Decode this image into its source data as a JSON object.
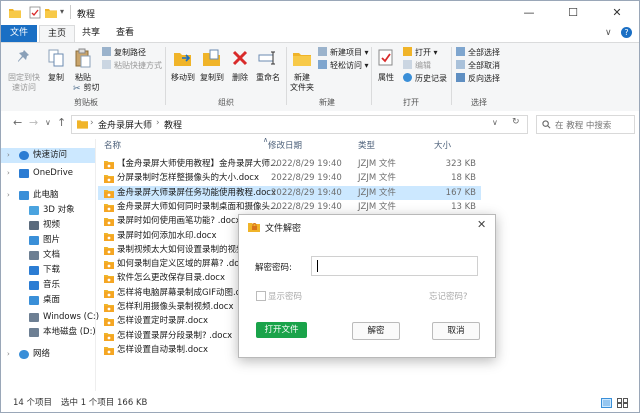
{
  "window": {
    "title": "教程",
    "controls": {
      "minimize": "—",
      "maximize": "☐",
      "close": "✕"
    },
    "quick_access": {
      "dropdown": "▾"
    }
  },
  "ribbon_tabs": [
    "文件",
    "主页",
    "共享",
    "查看"
  ],
  "ribbon": {
    "collapse_arrow": "∨",
    "help": "?",
    "clipboard": {
      "pin_line1": "固定到快",
      "pin_line2": "速访问",
      "copy": "复制",
      "paste": "粘贴",
      "copy_path": "复制路径",
      "paste_shortcut": "粘贴快捷方式",
      "cut": "剪切",
      "label": "剪贴板"
    },
    "organize": {
      "move_to": "移动到",
      "copy_to": "复制到",
      "delete": "删除",
      "rename": "重命名",
      "label": "组织"
    },
    "new": {
      "new_folder_line1": "新建",
      "new_folder_line2": "文件夹",
      "new_item": "新建项目 ▾",
      "easy_access": "轻松访问 ▾",
      "label": "新建"
    },
    "open": {
      "properties": "属性",
      "open": "打开 ▾",
      "edit": "编辑",
      "history": "历史记录",
      "label": "打开"
    },
    "select": {
      "select_all": "全部选择",
      "select_none": "全部取消",
      "invert": "反向选择",
      "label": "选择"
    }
  },
  "address_bar": {
    "back": "←",
    "forward": "→",
    "recent": "∨",
    "up": "↑",
    "crumbs": [
      "金舟录屏大师",
      "教程"
    ],
    "crumb_sep": "›",
    "dropdown": "∨",
    "refresh": "↻",
    "search_placeholder": "在 教程 中搜索"
  },
  "nav_pane": {
    "items": [
      {
        "label": "快速访问",
        "icon": "star-icon",
        "color": "#2b7cd3"
      },
      {
        "label": "OneDrive",
        "icon": "cloud-icon",
        "color": "#2b7cd3"
      },
      {
        "label": "此电脑",
        "icon": "computer-icon",
        "color": "#3a8fd8"
      },
      {
        "label": "3D 对象",
        "icon": "cube-icon",
        "color": "#4aa3df"
      },
      {
        "label": "视频",
        "icon": "video-icon",
        "color": "#5b6b7d"
      },
      {
        "label": "图片",
        "icon": "picture-icon",
        "color": "#3a8fd8"
      },
      {
        "label": "文档",
        "icon": "document-icon",
        "color": "#6d7f93"
      },
      {
        "label": "下载",
        "icon": "download-icon",
        "color": "#2b7cd3"
      },
      {
        "label": "音乐",
        "icon": "music-icon",
        "color": "#2b7cd3"
      },
      {
        "label": "桌面",
        "icon": "desktop-icon",
        "color": "#3a8fd8"
      },
      {
        "label": "Windows (C:)",
        "icon": "drive-icon",
        "color": "#6d7f93"
      },
      {
        "label": "本地磁盘 (D:)",
        "icon": "drive-icon",
        "color": "#6d7f93"
      },
      {
        "label": "网络",
        "icon": "network-icon",
        "color": "#3a8fd8"
      }
    ]
  },
  "file_list": {
    "columns": {
      "name": "名称",
      "date": "修改日期",
      "type": "类型",
      "size": "大小",
      "sort_arrow": "∧"
    },
    "rows": [
      {
        "name": "【金舟录屏大师使用教程】金舟录屏大师...",
        "date": "2022/8/29 19:40",
        "type": "JZJM 文件",
        "size": "323 KB"
      },
      {
        "name": "分屏录制时怎样整摄像头的大小.docx",
        "date": "2022/8/29 19:40",
        "type": "JZJM 文件",
        "size": "18 KB"
      },
      {
        "name": "金舟录屏大师录屏任务功能使用教程.docx",
        "date": "2022/8/29 19:40",
        "type": "JZJM 文件",
        "size": "167 KB"
      },
      {
        "name": "金舟录屏大师如何同时录制桌面和摄像头...",
        "date": "2022/8/29 19:40",
        "type": "JZJM 文件",
        "size": "13 KB"
      },
      {
        "name": "录屏时如何使用画笔功能? .docx",
        "date": "",
        "type": "",
        "size": ""
      },
      {
        "name": "录屏时如何添加水印.docx",
        "date": "",
        "type": "",
        "size": ""
      },
      {
        "name": "录制视频太大如何设置录制的视频小...",
        "date": "",
        "type": "",
        "size": ""
      },
      {
        "name": "如何录制自定义区域的屏幕? .docx",
        "date": "",
        "type": "",
        "size": ""
      },
      {
        "name": "软件怎么更改保存目录.docx",
        "date": "",
        "type": "",
        "size": ""
      },
      {
        "name": "怎样将电脑屏幕录制成GIF动图.docx",
        "date": "",
        "type": "",
        "size": ""
      },
      {
        "name": "怎样利用摄像头录制视频.docx",
        "date": "",
        "type": "",
        "size": ""
      },
      {
        "name": "怎样设置定时录屏.docx",
        "date": "",
        "type": "",
        "size": ""
      },
      {
        "name": "怎样设置录屏分段录制? .docx",
        "date": "",
        "type": "",
        "size": ""
      },
      {
        "name": "怎样设置自动录制.docx",
        "date": "",
        "type": "",
        "size": ""
      }
    ],
    "selected_index": 2
  },
  "status_bar": {
    "count": "14 个项目",
    "selected": "选中 1 个项目  166 KB"
  },
  "dialog": {
    "title": "文件解密",
    "close": "✕",
    "password_label": "解密密码:",
    "show_password": "显示密码",
    "forgot": "忘记密码?",
    "open_file": "打开文件",
    "decrypt": "解密",
    "cancel": "取消"
  },
  "colors": {
    "accent": "#1a6fc4",
    "selection": "#cce8ff",
    "folder": "#f0b429",
    "file_icon": "#f5a623",
    "delete": "#d92b2b",
    "dialog_primary": "#1aa34a"
  }
}
